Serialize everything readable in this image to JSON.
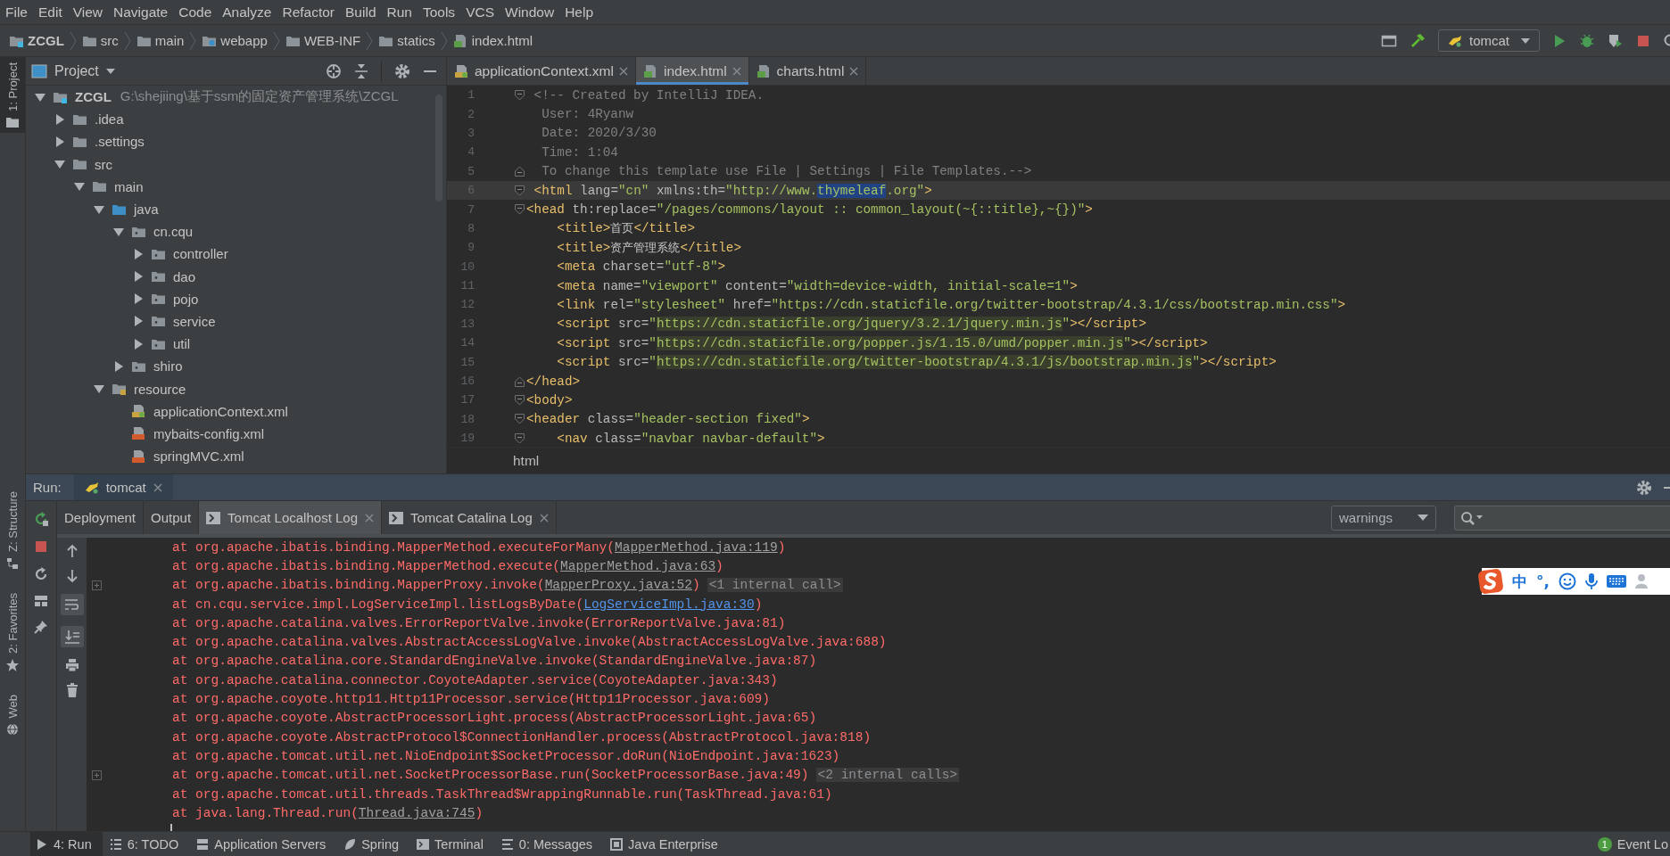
{
  "menu": [
    "File",
    "Edit",
    "View",
    "Navigate",
    "Code",
    "Analyze",
    "Refactor",
    "Build",
    "Run",
    "Tools",
    "VCS",
    "Window",
    "Help"
  ],
  "breadcrumbs": [
    {
      "label": "ZCGL",
      "kind": "module"
    },
    {
      "label": "src",
      "kind": "folder"
    },
    {
      "label": "main",
      "kind": "folder"
    },
    {
      "label": "webapp",
      "kind": "web"
    },
    {
      "label": "WEB-INF",
      "kind": "folder"
    },
    {
      "label": "statics",
      "kind": "folder"
    },
    {
      "label": "index.html",
      "kind": "html"
    }
  ],
  "run_config": "tomcat",
  "side_tabs_top": [
    {
      "label": "1: Project",
      "selected": true
    }
  ],
  "side_tabs_bottom": [
    {
      "label": "Z: Structure",
      "kind": "structure"
    },
    {
      "label": "2: Favorites",
      "kind": "star"
    },
    {
      "label": "Web",
      "kind": "globe"
    }
  ],
  "project": {
    "title": "Project",
    "tree": [
      {
        "label": "ZCGL",
        "kind": "module",
        "path": "G:\\shejiing\\基于ssm的固定资产管理系统\\ZCGL",
        "expanded": true,
        "children": [
          {
            "label": ".idea",
            "kind": "folder",
            "expanded": false
          },
          {
            "label": ".settings",
            "kind": "folder",
            "expanded": false
          },
          {
            "label": "src",
            "kind": "folder",
            "expanded": true,
            "children": [
              {
                "label": "main",
                "kind": "folder",
                "expanded": true,
                "children": [
                  {
                    "label": "java",
                    "kind": "source",
                    "expanded": true,
                    "children": [
                      {
                        "label": "cn.cqu",
                        "kind": "package",
                        "expanded": true,
                        "children": [
                          {
                            "label": "controller",
                            "kind": "package",
                            "expanded": false
                          },
                          {
                            "label": "dao",
                            "kind": "package",
                            "expanded": false
                          },
                          {
                            "label": "pojo",
                            "kind": "package",
                            "expanded": false
                          },
                          {
                            "label": "service",
                            "kind": "package",
                            "expanded": false
                          },
                          {
                            "label": "util",
                            "kind": "package",
                            "expanded": false
                          }
                        ]
                      },
                      {
                        "label": "shiro",
                        "kind": "package",
                        "expanded": false
                      }
                    ]
                  },
                  {
                    "label": "resource",
                    "kind": "resource",
                    "expanded": true,
                    "children": [
                      {
                        "label": "applicationContext.xml",
                        "kind": "spring-xml"
                      },
                      {
                        "label": "mybaits-config.xml",
                        "kind": "xml"
                      },
                      {
                        "label": "springMVC.xml",
                        "kind": "xml"
                      }
                    ]
                  }
                ]
              }
            ]
          }
        ]
      }
    ]
  },
  "editor_tabs": [
    {
      "label": "applicationContext.xml",
      "kind": "spring-xml",
      "selected": false
    },
    {
      "label": "index.html",
      "kind": "html",
      "selected": true
    },
    {
      "label": "charts.html",
      "kind": "html",
      "selected": false
    }
  ],
  "code": [
    {
      "no": "1",
      "fold_start": true,
      "segments": [
        {
          "kind": "comment",
          "text": " <!-- Created by IntelliJ IDEA."
        }
      ]
    },
    {
      "no": "2",
      "segments": [
        {
          "kind": "comment",
          "text": "  User: 4Ryanw"
        }
      ]
    },
    {
      "no": "3",
      "segments": [
        {
          "kind": "comment",
          "text": "  Date: 2020/3/30"
        }
      ]
    },
    {
      "no": "4",
      "segments": [
        {
          "kind": "comment",
          "text": "  Time: 1:04"
        }
      ]
    },
    {
      "no": "5",
      "fold_end": true,
      "segments": [
        {
          "kind": "comment",
          "text": "  To change this template use File | Settings | File Templates.-->"
        }
      ]
    },
    {
      "no": "6",
      "fold_start": true,
      "current": true,
      "segments": [
        {
          "kind": "tag",
          "text": " <html "
        },
        {
          "kind": "attr",
          "text": "lang="
        },
        {
          "kind": "value",
          "text": "\"cn\" "
        },
        {
          "kind": "attr",
          "text": "xmlns:th="
        },
        {
          "kind": "value",
          "text": "\"http://www."
        },
        {
          "kind": "match",
          "text": "thymeleaf"
        },
        {
          "kind": "value",
          "text": ".org\""
        },
        {
          "kind": "tag",
          "text": ">"
        }
      ]
    },
    {
      "no": "7",
      "fold_start": true,
      "segments": [
        {
          "kind": "tag",
          "text": "<head "
        },
        {
          "kind": "attr",
          "text": "th:replace="
        },
        {
          "kind": "value",
          "text": "\"/pages/commons/layout :: common_layout(~{::title},~{})\""
        },
        {
          "kind": "tag",
          "text": ">"
        }
      ]
    },
    {
      "no": "8",
      "segments": [
        {
          "kind": "tag",
          "text": "    <title>"
        },
        {
          "kind": "text",
          "text": "首页"
        },
        {
          "kind": "tag",
          "text": "</title>"
        }
      ]
    },
    {
      "no": "9",
      "segments": [
        {
          "kind": "tag",
          "text": "    <title>"
        },
        {
          "kind": "text",
          "text": "资产管理系统"
        },
        {
          "kind": "tag",
          "text": "</title>"
        }
      ]
    },
    {
      "no": "10",
      "segments": [
        {
          "kind": "tag",
          "text": "    <meta "
        },
        {
          "kind": "attr",
          "text": "charset="
        },
        {
          "kind": "value",
          "text": "\"utf-8\""
        },
        {
          "kind": "tag",
          "text": ">"
        }
      ]
    },
    {
      "no": "11",
      "segments": [
        {
          "kind": "tag",
          "text": "    <meta "
        },
        {
          "kind": "attr",
          "text": "name="
        },
        {
          "kind": "value",
          "text": "\"viewport\" "
        },
        {
          "kind": "attr",
          "text": "content="
        },
        {
          "kind": "value",
          "text": "\"width=device-width, initial-scale=1\""
        },
        {
          "kind": "tag",
          "text": ">"
        }
      ]
    },
    {
      "no": "12",
      "segments": [
        {
          "kind": "tag",
          "text": "    <link "
        },
        {
          "kind": "attr",
          "text": "rel="
        },
        {
          "kind": "value",
          "text": "\"stylesheet\" "
        },
        {
          "kind": "attr",
          "text": "href="
        },
        {
          "kind": "value",
          "text": "\"https://cdn.staticfile.org/twitter-bootstrap/4.3.1/css/bootstrap.min.css\""
        },
        {
          "kind": "tag",
          "text": ">"
        }
      ]
    },
    {
      "no": "13",
      "segments": [
        {
          "kind": "tag",
          "text": "    <script "
        },
        {
          "kind": "attr",
          "text": "src="
        },
        {
          "kind": "value",
          "text": "\""
        },
        {
          "kind": "url",
          "text": "https://cdn.staticfile.org/jquery/3.2.1/jquery.min.js"
        },
        {
          "kind": "value",
          "text": "\""
        },
        {
          "kind": "tag",
          "text": "></script>"
        }
      ]
    },
    {
      "no": "14",
      "segments": [
        {
          "kind": "tag",
          "text": "    <script "
        },
        {
          "kind": "attr",
          "text": "src="
        },
        {
          "kind": "value",
          "text": "\""
        },
        {
          "kind": "url",
          "text": "https://cdn.staticfile.org/popper.js/1.15.0/umd/popper.min.js"
        },
        {
          "kind": "value",
          "text": "\""
        },
        {
          "kind": "tag",
          "text": "></script>"
        }
      ]
    },
    {
      "no": "15",
      "segments": [
        {
          "kind": "tag",
          "text": "    <script "
        },
        {
          "kind": "attr",
          "text": "src="
        },
        {
          "kind": "value",
          "text": "\""
        },
        {
          "kind": "url",
          "text": "https://cdn.staticfile.org/twitter-bootstrap/4.3.1/js/bootstrap.min.js"
        },
        {
          "kind": "value",
          "text": "\""
        },
        {
          "kind": "tag",
          "text": "></script>"
        }
      ]
    },
    {
      "no": "16",
      "fold_end": true,
      "segments": [
        {
          "kind": "tag",
          "text": "</head>"
        }
      ]
    },
    {
      "no": "17",
      "fold_start": true,
      "segments": [
        {
          "kind": "tag",
          "text": "<body>"
        }
      ]
    },
    {
      "no": "18",
      "fold_start": true,
      "segments": [
        {
          "kind": "tag",
          "text": "<header "
        },
        {
          "kind": "attr",
          "text": "class="
        },
        {
          "kind": "value",
          "text": "\"header-section fixed\""
        },
        {
          "kind": "tag",
          "text": ">"
        }
      ]
    },
    {
      "no": "19",
      "fold_start": true,
      "segments": [
        {
          "kind": "tag",
          "text": "    <nav "
        },
        {
          "kind": "attr",
          "text": "class="
        },
        {
          "kind": "value",
          "text": "\"navbar navbar-default\""
        },
        {
          "kind": "tag",
          "text": ">"
        }
      ]
    }
  ],
  "editor_breadcrumb": "html",
  "run": {
    "label": "Run:",
    "config_tab": "tomcat",
    "tabs": [
      {
        "label": "Deployment",
        "closable": false,
        "selected": false
      },
      {
        "label": "Output",
        "closable": false,
        "selected": false
      },
      {
        "label": "Tomcat Localhost Log",
        "closable": true,
        "selected": true
      },
      {
        "label": "Tomcat Catalina Log",
        "closable": true,
        "selected": false
      }
    ],
    "filter": "warnings",
    "caret": true,
    "lines": [
      {
        "text": "at org.apache.ibatis.binding.MapperMethod.executeForMany(",
        "link": "MapperMethod.java:119",
        "project_link": false,
        "after": ")"
      },
      {
        "text": "at org.apache.ibatis.binding.MapperMethod.execute(",
        "link": "MapperMethod.java:63",
        "project_link": false,
        "after": ")"
      },
      {
        "text": "at org.apache.ibatis.binding.MapperProxy.invoke(",
        "link": "MapperProxy.java:52",
        "project_link": false,
        "after": ")",
        "note": "<1 internal call>"
      },
      {
        "text": "at cn.cqu.service.impl.LogServiceImpl.listLogsByDate(",
        "link": "LogServiceImpl.java:30",
        "project_link": true,
        "after": ")"
      },
      {
        "text": "at org.apache.catalina.valves.ErrorReportValve.invoke(ErrorReportValve.java:81)"
      },
      {
        "text": "at org.apache.catalina.valves.AbstractAccessLogValve.invoke(AbstractAccessLogValve.java:688)"
      },
      {
        "text": "at org.apache.catalina.core.StandardEngineValve.invoke(StandardEngineValve.java:87)"
      },
      {
        "text": "at org.apache.catalina.connector.CoyoteAdapter.service(CoyoteAdapter.java:343)"
      },
      {
        "text": "at org.apache.coyote.http11.Http11Processor.service(Http11Processor.java:609)"
      },
      {
        "text": "at org.apache.coyote.AbstractProcessorLight.process(AbstractProcessorLight.java:65)"
      },
      {
        "text": "at org.apache.coyote.AbstractProtocol$ConnectionHandler.process(AbstractProtocol.java:818)"
      },
      {
        "text": "at org.apache.tomcat.util.net.NioEndpoint$SocketProcessor.doRun(NioEndpoint.java:1623)"
      },
      {
        "text": "at org.apache.tomcat.util.net.SocketProcessorBase.run(SocketProcessorBase.java:49)",
        "note": "<2 internal calls>"
      },
      {
        "text": "at org.apache.tomcat.util.threads.TaskThread$WrappingRunnable.run(TaskThread.java:61)"
      },
      {
        "text": "at java.lang.Thread.run(",
        "link": "Thread.java:745",
        "project_link": false,
        "after": ")"
      }
    ]
  },
  "ime_toolbar": {
    "labels": [
      "中",
      "°,"
    ]
  },
  "bottom_tabs": [
    {
      "label": "4: Run",
      "kind": "run",
      "selected": true
    },
    {
      "label": "6: TODO",
      "kind": "todo",
      "selected": false
    },
    {
      "label": "Application Servers",
      "kind": "servers",
      "selected": false
    },
    {
      "label": "Spring",
      "kind": "spring",
      "selected": false
    },
    {
      "label": "Terminal",
      "kind": "terminal",
      "selected": false
    },
    {
      "label": "0: Messages",
      "kind": "messages",
      "selected": false
    },
    {
      "label": "Java Enterprise",
      "kind": "enterprise",
      "selected": false
    }
  ],
  "event_log": {
    "badge": "1",
    "label": "Event Lo"
  }
}
